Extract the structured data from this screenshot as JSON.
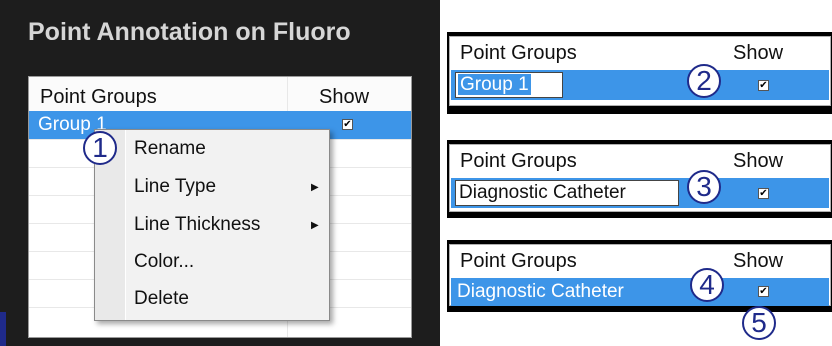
{
  "left": {
    "title": "Point Annotation on Fluoro",
    "table": {
      "col_name": "Point Groups",
      "col_show": "Show",
      "rows": [
        {
          "name": "Group 1",
          "show": true,
          "selected": true
        }
      ]
    },
    "context_menu": {
      "items": [
        {
          "label": "Rename",
          "has_submenu": false
        },
        {
          "label": "Line Type",
          "has_submenu": true
        },
        {
          "label": "Line Thickness",
          "has_submenu": true
        },
        {
          "label": "Color...",
          "has_submenu": false
        },
        {
          "label": "Delete",
          "has_submenu": false
        }
      ]
    },
    "callout": "1"
  },
  "step2": {
    "col_name": "Point Groups",
    "col_show": "Show",
    "edit_value": "Group 1",
    "show": true,
    "callout": "2"
  },
  "step3": {
    "col_name": "Point Groups",
    "col_show": "Show",
    "edit_value": "Diagnostic Catheter",
    "show": true,
    "callout": "3"
  },
  "step4": {
    "col_name": "Point Groups",
    "col_show": "Show",
    "row_value": "Diagnostic Catheter",
    "show": true,
    "callout": "4",
    "callout_show": "5"
  },
  "colors": {
    "selection_blue": "#3d95e8",
    "callout_navy": "#1f2a8a",
    "panel_dark": "#1d1d1d"
  },
  "icons": {
    "checkbox": "checkbox-checked-icon",
    "submenu": "submenu-arrow-icon"
  }
}
